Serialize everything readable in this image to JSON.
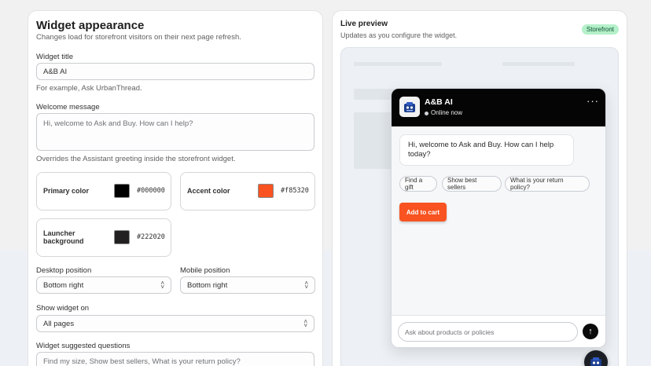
{
  "settings": {
    "title": "Widget appearance",
    "subtitle": "Changes load for storefront visitors on their next page refresh.",
    "widget_title": {
      "label": "Widget title",
      "value": "A&B AI",
      "help": "For example, Ask UrbanThread."
    },
    "welcome_message": {
      "label": "Welcome message",
      "placeholder": "Hi, welcome to Ask and Buy. How can I help?",
      "help": "Overrides the Assistant greeting inside the storefront widget."
    },
    "colors": {
      "primary": {
        "label": "Primary color",
        "hex": "#000000"
      },
      "accent": {
        "label": "Accent color",
        "hex": "#f85320"
      },
      "launcher": {
        "label_line1": "Launcher",
        "label_line2": "background",
        "hex": "#222020"
      }
    },
    "desktop_position": {
      "label": "Desktop position",
      "value": "Bottom right"
    },
    "mobile_position": {
      "label": "Mobile position",
      "value": "Bottom right"
    },
    "show_widget_on": {
      "label": "Show widget on",
      "value": "All pages"
    },
    "suggested_questions": {
      "label": "Widget suggested questions",
      "placeholder": "Find my size, Show best sellers, What is your return policy?"
    }
  },
  "preview": {
    "title": "Live preview",
    "subtitle": "Updates as you configure the widget.",
    "badge": "Storefront",
    "widget": {
      "name": "A&B AI",
      "status": "Online now",
      "menu": "···",
      "greeting": "Hi, welcome to Ask and Buy. How can I help today?",
      "chips": [
        "Find a gift",
        "Show best sellers",
        "What is your return policy?"
      ],
      "cta": "Add to cart",
      "input_placeholder": "Ask about products or policies",
      "send_icon": "↑"
    }
  },
  "icons": {
    "select": "chevron-up-down-icon",
    "send": "arrow-up-icon",
    "avatar": "bot-avatar-icon"
  },
  "colors": {
    "accent": "#f85320",
    "badge_bg": "#b4f0c9",
    "header_bg": "#050505"
  }
}
